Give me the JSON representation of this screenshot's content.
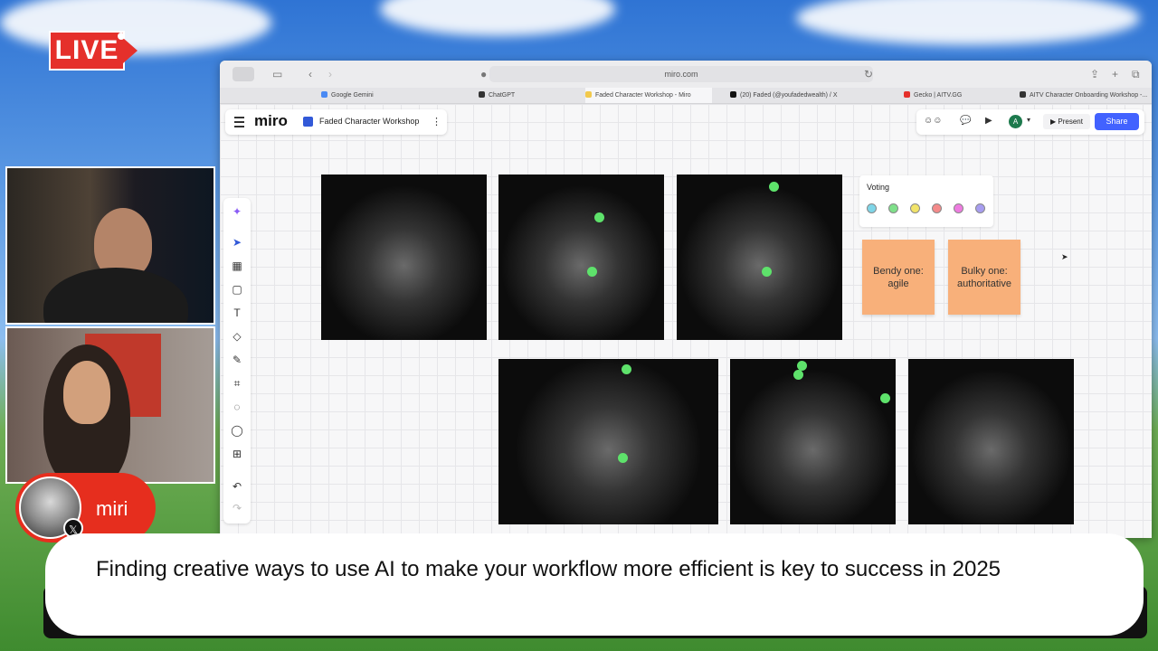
{
  "stream": {
    "live_label": "LIVE",
    "speaker_name": "miri",
    "caption": "Finding creative ways to use AI to make your workflow more efficient is key to success in 2025"
  },
  "browser": {
    "url": "miro.com",
    "tabs": [
      {
        "label": "Google Gemini",
        "icon_color": "#4a8af4"
      },
      {
        "label": "ChatGPT",
        "icon_color": "#333333"
      },
      {
        "label": "Faded Character Workshop - Miro",
        "icon_color": "#f2c94c"
      },
      {
        "label": "(20) Faded (@youfadedwealth) / X",
        "icon_color": "#111111"
      },
      {
        "label": "Gecko | AITV.GG",
        "icon_color": "#e5302b"
      },
      {
        "label": "AITV Character Onboarding Workshop -...",
        "icon_color": "#333333"
      }
    ]
  },
  "miro": {
    "logo": "miro",
    "board_title": "Faded Character Workshop",
    "present_label": "Present",
    "share_label": "Share",
    "avatar_initial": "A",
    "voting": {
      "title": "Voting",
      "dot_colors": [
        "#7fd6e8",
        "#7fe08a",
        "#f2e46a",
        "#f48a8a",
        "#ee7be0",
        "#a79df0"
      ]
    },
    "stickies": [
      {
        "text": "Bendy one: agile"
      },
      {
        "text": "Bulky one: authoritative"
      }
    ]
  }
}
